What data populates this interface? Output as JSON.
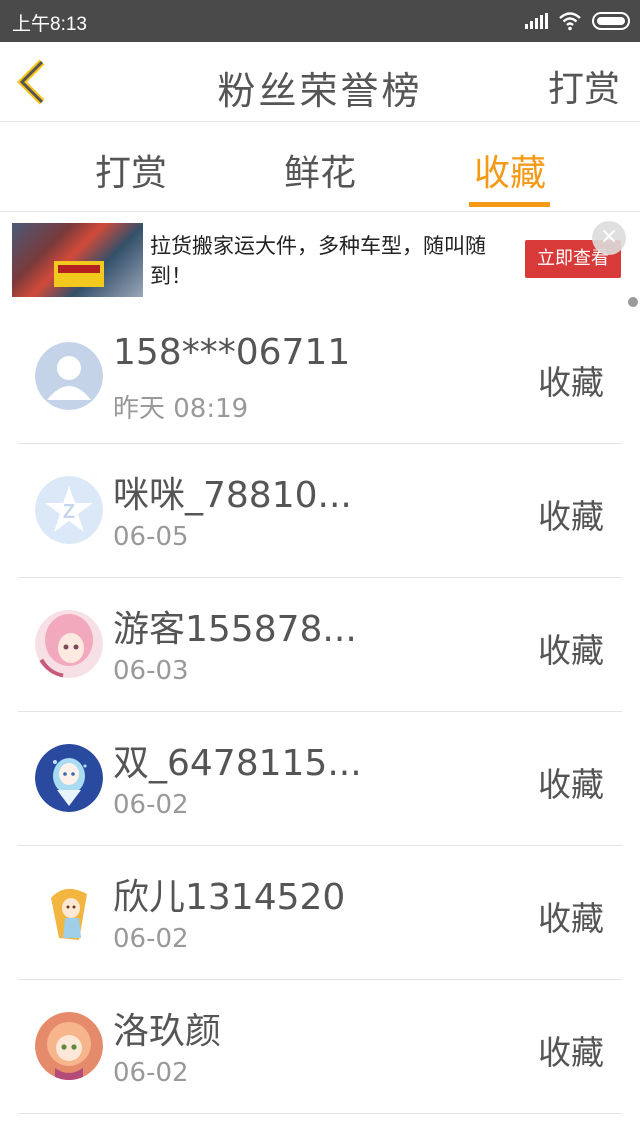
{
  "status_bar": {
    "time": "上午8:13"
  },
  "header": {
    "title": "粉丝荣誉榜",
    "right_label": "打赏"
  },
  "tabs": [
    {
      "label": "打赏",
      "active": false
    },
    {
      "label": "鲜花",
      "active": false
    },
    {
      "label": "收藏",
      "active": true
    }
  ],
  "colors": {
    "accent": "#f59a17",
    "ad_button": "#d83a3a"
  },
  "ad": {
    "text": "拉货搬家运大件，多种车型，随叫随到！",
    "button_label": "立即查看"
  },
  "list": [
    {
      "name": "158***06711",
      "date": "昨天 08:19",
      "action": "收藏",
      "avatar": "default-person-icon"
    },
    {
      "name": "咪咪_78810...",
      "date": "06-05",
      "action": "收藏",
      "avatar": "star-badge-icon"
    },
    {
      "name": "游客155878...",
      "date": "06-03",
      "action": "收藏",
      "avatar": "anime-girl-pink"
    },
    {
      "name": "双_6478115...",
      "date": "06-02",
      "action": "收藏",
      "avatar": "anime-girl-blue"
    },
    {
      "name": "欣儿1314520",
      "date": "06-02",
      "action": "收藏",
      "avatar": "anime-girl-yellow"
    },
    {
      "name": "洛玖颜",
      "date": "06-02",
      "action": "收藏",
      "avatar": "anime-girl-peach"
    }
  ]
}
